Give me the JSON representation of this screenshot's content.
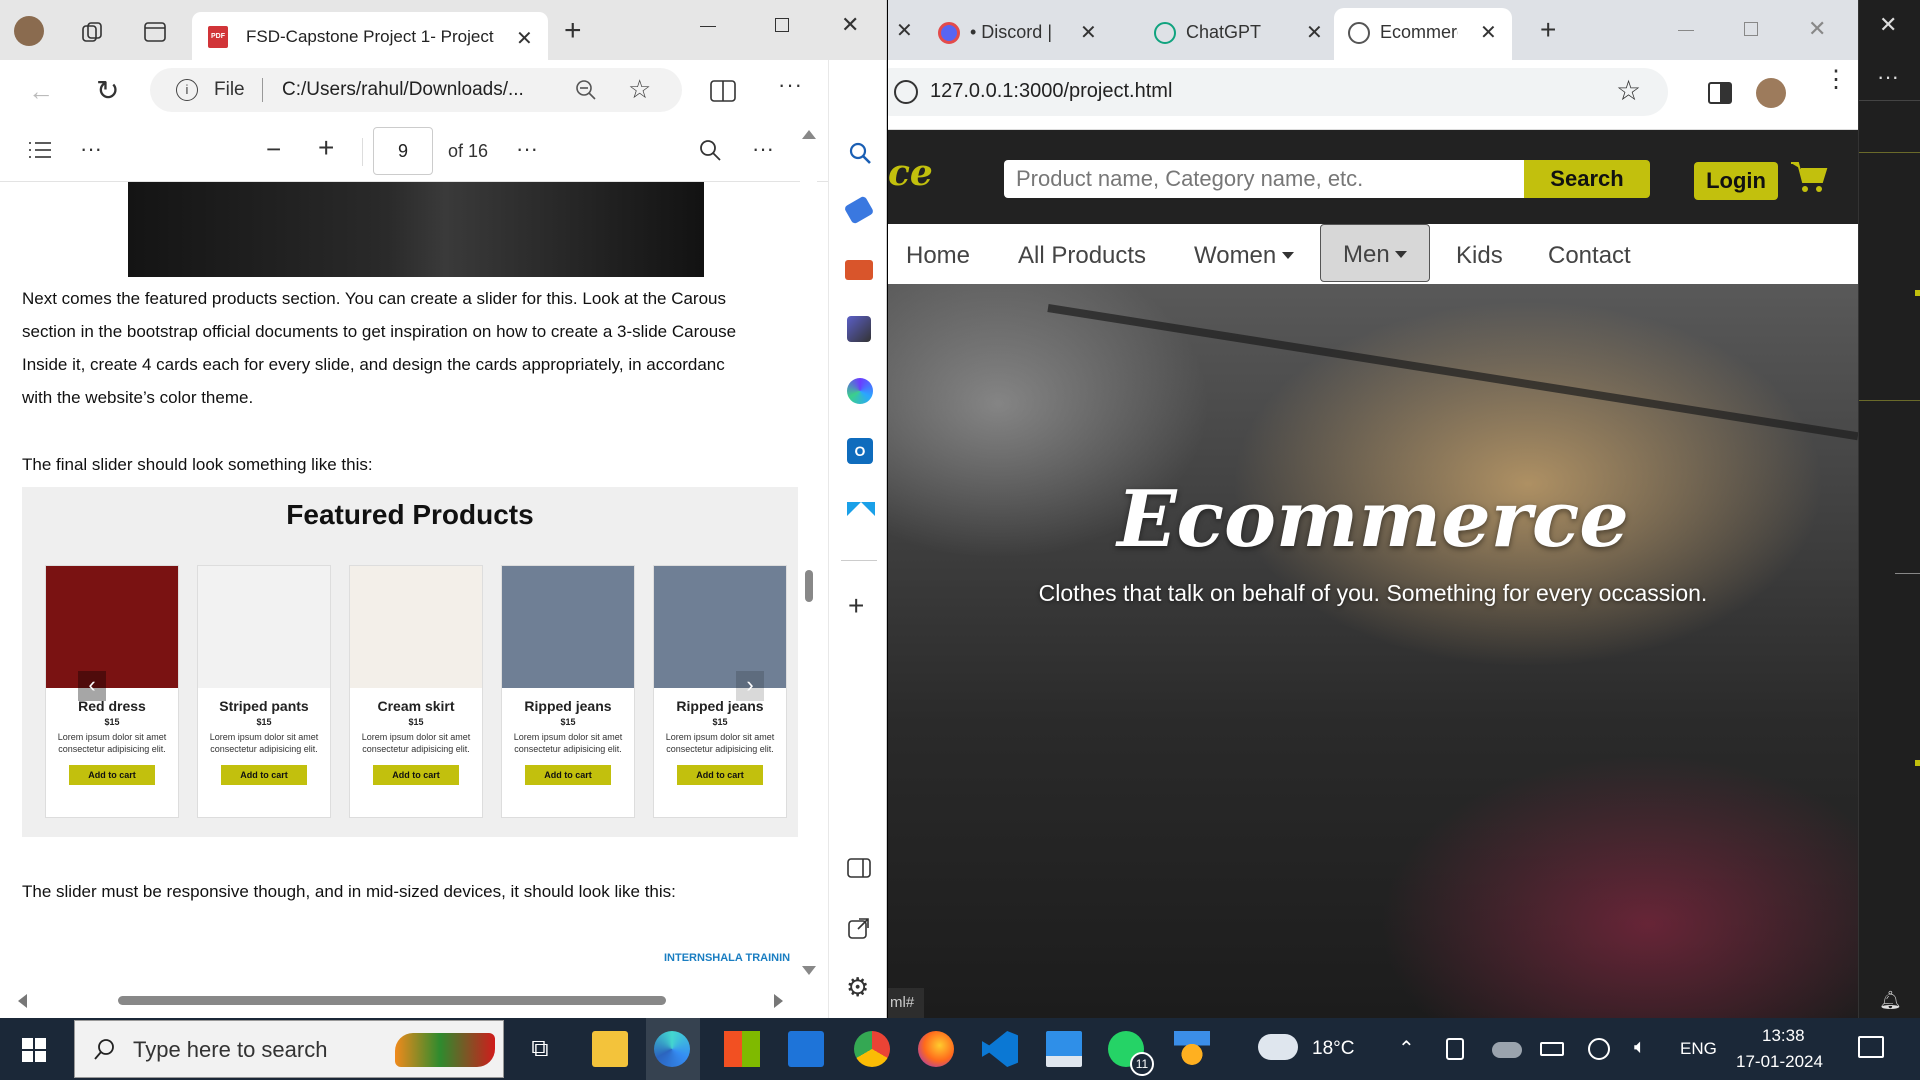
{
  "edge": {
    "tab_title": "FSD-Capstone Project 1- Project",
    "address_prefix": "File",
    "address": "C:/Users/rahul/Downloads/...",
    "pdf": {
      "page_number": "9",
      "page_total": "of 16"
    },
    "paragraph1": [
      "Next comes the featured products section. You can create a slider for this. Look at the Carous",
      "section in the bootstrap official documents to get inspiration on how to create a 3-slide Carouse",
      "Inside it, create 4 cards each for every slide, and design the cards appropriately, in accordanc",
      "with the website’s color theme."
    ],
    "paragraph2": "The final slider should look something like this:",
    "featured_title": "Featured Products",
    "cards": [
      {
        "title": "Red dress",
        "price": "$15",
        "desc": "Lorem ipsum dolor sit amet consectetur adipisicing elit.",
        "button": "Add to cart",
        "color": "#7a1212"
      },
      {
        "title": "Striped pants",
        "price": "$15",
        "desc": "Lorem ipsum dolor sit amet consectetur adipisicing elit.",
        "button": "Add to cart",
        "color": "#f2f2f2"
      },
      {
        "title": "Cream skirt",
        "price": "$15",
        "desc": "Lorem ipsum dolor sit amet consectetur adipisicing elit.",
        "button": "Add to cart",
        "color": "#f3efe9"
      },
      {
        "title": "Ripped jeans",
        "price": "$15",
        "desc": "Lorem ipsum dolor sit amet consectetur adipisicing elit.",
        "button": "Add to cart",
        "color": "#6f7f95"
      },
      {
        "title": "Ripped jeans",
        "price": "$15",
        "desc": "Lorem ipsum dolor sit amet consectetur adipisicing elit.",
        "button": "Add to cart",
        "color": "#6f7f95"
      }
    ],
    "paragraph3": "The slider must be responsive though, and in mid-sized devices, it should look like this:",
    "footer_logo": "INTERNSHALA TRAININ"
  },
  "chrome": {
    "tabs": [
      {
        "label": "• Discord |"
      },
      {
        "label": "ChatGPT"
      },
      {
        "label": "Ecommerce"
      }
    ],
    "url": "127.0.0.1:3000/project.html",
    "site": {
      "logo_fragment": "ce",
      "search_placeholder": "Product name, Category name, etc.",
      "search_button": "Search",
      "login": "Login",
      "nav": [
        "Home",
        "All Products",
        "Women",
        "Men",
        "Kids",
        "Contact"
      ],
      "hero_title": "Ecommerce",
      "hero_subtitle": "Clothes that talk on behalf of you. Something for every occassion.",
      "status_fragment": "ml#"
    }
  },
  "taskbar": {
    "search_placeholder": "Type here to search",
    "weather": "18°C",
    "language": "ENG",
    "time": "13:38",
    "date": "17-01-2024",
    "whatsapp_badge": "11"
  },
  "colors": {
    "accent_yellow": "#c2c00d",
    "taskbar": "#1b2838",
    "site_header": "#222222"
  }
}
